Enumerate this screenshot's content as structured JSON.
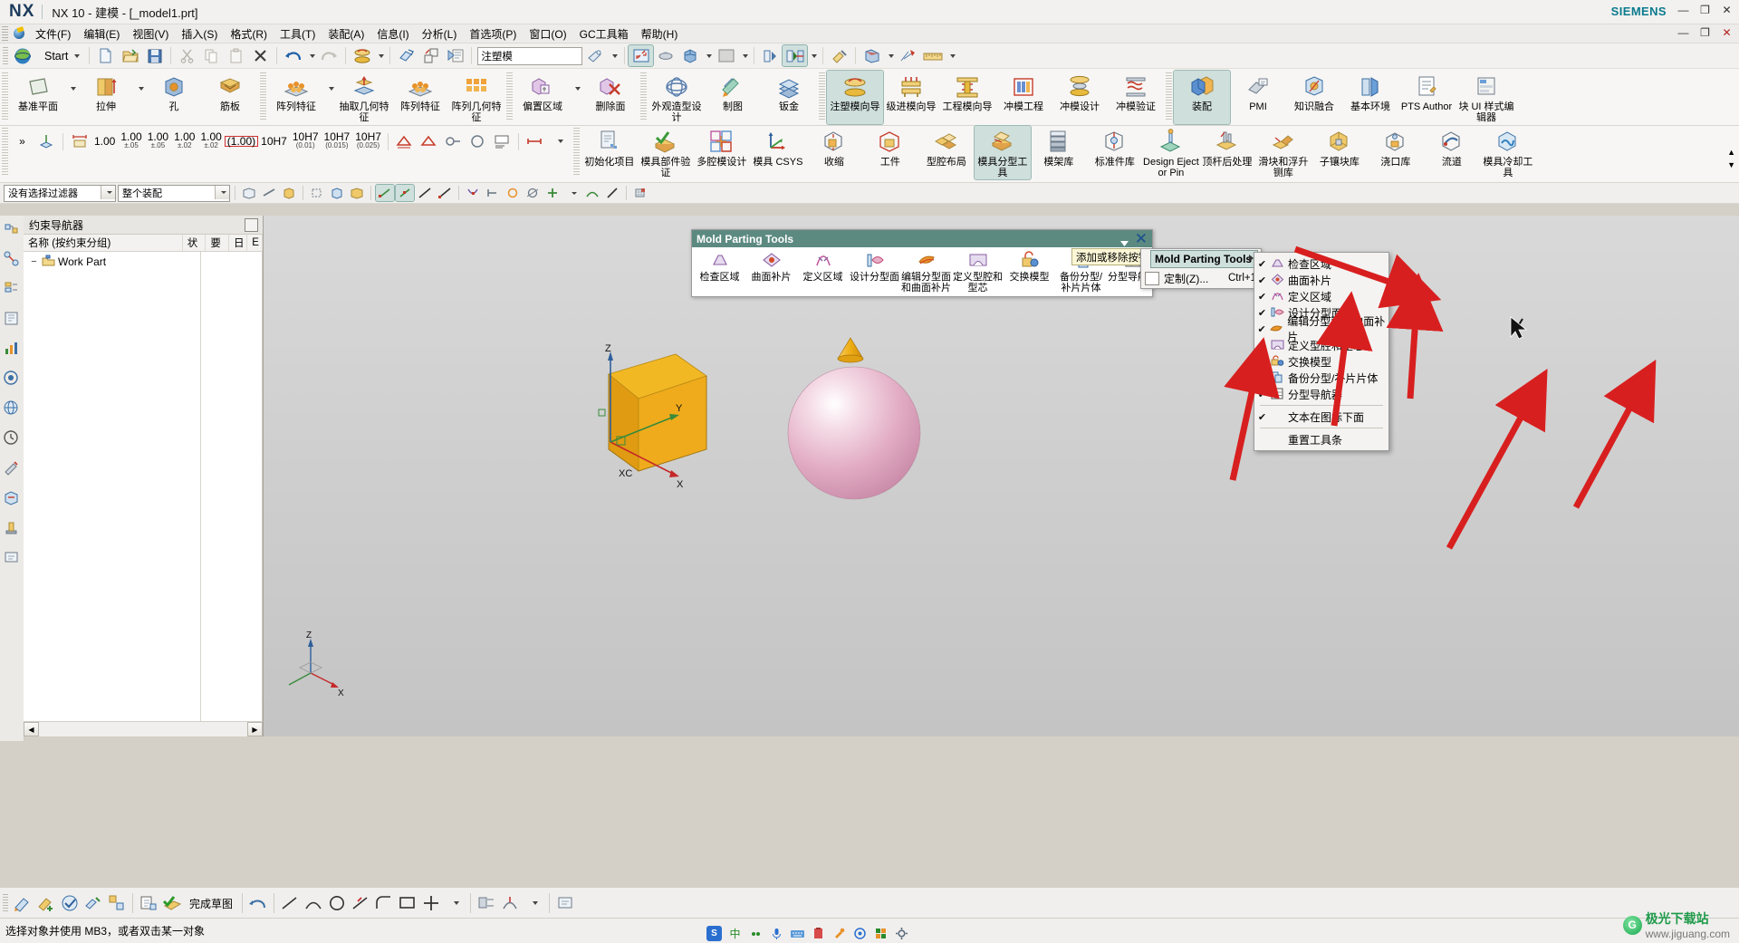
{
  "titlebar": {
    "logo": "NX",
    "title": "NX 10 - 建模 - [_model1.prt]",
    "brand": "SIEMENS",
    "minimize": "—",
    "maximize": "❐",
    "close": "✕"
  },
  "menubar": {
    "items": [
      {
        "label": "文件(F)"
      },
      {
        "label": "编辑(E)"
      },
      {
        "label": "视图(V)"
      },
      {
        "label": "插入(S)"
      },
      {
        "label": "格式(R)"
      },
      {
        "label": "工具(T)"
      },
      {
        "label": "装配(A)"
      },
      {
        "label": "信息(I)"
      },
      {
        "label": "分析(L)"
      },
      {
        "label": "首选项(P)"
      },
      {
        "label": "窗口(O)"
      },
      {
        "label": "GC工具箱"
      },
      {
        "label": "帮助(H)"
      }
    ],
    "minimize": "—",
    "restore": "❐",
    "close": "✕"
  },
  "quick_access": {
    "start_label": "Start",
    "search_value": "注塑模",
    "items": [
      "start-menu",
      "new-file",
      "open-file",
      "save-file",
      "cut",
      "copy",
      "paste",
      "delete",
      "undo",
      "redo",
      "mold-wizard",
      "transform",
      "move-object",
      "properties"
    ]
  },
  "ribbon_row1": [
    {
      "label": "基准平面",
      "icon": "datum-plane-icon",
      "dropdown": true,
      "selected": false
    },
    {
      "label": "拉伸",
      "icon": "extrude-icon",
      "dropdown": true,
      "selected": false
    },
    {
      "label": "孔",
      "icon": "hole-icon",
      "dropdown": false,
      "selected": false
    },
    {
      "label": "筋板",
      "icon": "rib-icon",
      "dropdown": false,
      "selected": false
    },
    {
      "label": "阵列特征",
      "icon": "pattern-feature-icon",
      "dropdown": true,
      "selected": false
    },
    {
      "label": "抽取几何特征",
      "icon": "extract-geometry-icon",
      "dropdown": false,
      "selected": false
    },
    {
      "label": "阵列特征",
      "icon": "pattern-feature2-icon",
      "dropdown": false,
      "selected": false
    },
    {
      "label": "阵列几何特征",
      "icon": "pattern-geometry-icon",
      "dropdown": false,
      "selected": false
    },
    {
      "label": "偏置区域",
      "icon": "offset-region-icon",
      "dropdown": true,
      "selected": false
    },
    {
      "label": "删除面",
      "icon": "delete-face-icon",
      "dropdown": false,
      "selected": false
    },
    {
      "label": "外观造型设计",
      "icon": "styling-design-icon",
      "dropdown": false,
      "selected": false
    },
    {
      "label": "制图",
      "icon": "drafting-icon",
      "dropdown": false,
      "selected": false
    },
    {
      "label": "钣金",
      "icon": "sheet-metal-icon",
      "dropdown": false,
      "selected": false
    },
    {
      "label": "注塑模向导",
      "icon": "mold-wizard-icon",
      "dropdown": false,
      "selected": true
    },
    {
      "label": "级进模向导",
      "icon": "progressive-die-icon",
      "dropdown": false,
      "selected": false
    },
    {
      "label": "工程模向导",
      "icon": "die-engineering-icon",
      "dropdown": false,
      "selected": false
    },
    {
      "label": "冲模工程",
      "icon": "stamping-die-icon",
      "dropdown": false,
      "selected": false
    },
    {
      "label": "冲模设计",
      "icon": "die-design-icon",
      "dropdown": false,
      "selected": false
    },
    {
      "label": "冲模验证",
      "icon": "die-validation-icon",
      "dropdown": false,
      "selected": false
    },
    {
      "label": "装配",
      "icon": "assembly-icon",
      "dropdown": false,
      "selected": true
    },
    {
      "label": "PMI",
      "icon": "pmi-icon",
      "dropdown": false,
      "selected": false
    },
    {
      "label": "知识融合",
      "icon": "knowledge-fusion-icon",
      "dropdown": false,
      "selected": false
    },
    {
      "label": "基本环境",
      "icon": "gateway-icon",
      "dropdown": false,
      "selected": false
    },
    {
      "label": "PTS Author",
      "icon": "pts-author-icon",
      "dropdown": false,
      "selected": false
    },
    {
      "label": "块 UI 样式编辑器",
      "icon": "block-ui-styler-icon",
      "dropdown": false,
      "selected": false
    }
  ],
  "ribbon_row2_dims": [
    {
      "value": "1.00",
      "tol": ""
    },
    {
      "value": "1.00",
      "tol": "±.05"
    },
    {
      "value": "1.00",
      "tol": "±.05"
    },
    {
      "value": "1.00",
      "tol": "±.02"
    },
    {
      "value": "1.00",
      "tol": "±.02"
    },
    {
      "value": "(1.00)",
      "tol": "",
      "boxed": true
    },
    {
      "value": "10H7",
      "tol": ""
    },
    {
      "value": "10H7",
      "tol": "(0.01)"
    },
    {
      "value": "10H7",
      "tol": "(0.015)"
    },
    {
      "value": "10H7",
      "tol": "(0.025)"
    }
  ],
  "ribbon_row2_tools": [
    {
      "label": "初始化项目",
      "icon": "init-project-icon"
    },
    {
      "label": "模具部件验证",
      "icon": "part-validation-icon"
    },
    {
      "label": "多腔模设计",
      "icon": "multi-cavity-icon"
    },
    {
      "label": "模具 CSYS",
      "icon": "mold-csys-icon"
    },
    {
      "label": "收缩",
      "icon": "shrinkage-icon"
    },
    {
      "label": "工件",
      "icon": "workpiece-icon"
    },
    {
      "label": "型腔布局",
      "icon": "cavity-layout-icon"
    },
    {
      "label": "模具分型工具",
      "icon": "mold-parting-tools-icon",
      "selected": true
    },
    {
      "label": "模架库",
      "icon": "mold-base-library-icon"
    },
    {
      "label": "标准件库",
      "icon": "standard-part-library-icon"
    },
    {
      "label": "Design Ejector Pin",
      "icon": "design-ejector-pin-icon"
    },
    {
      "label": "顶杆后处理",
      "icon": "ejector-post-process-icon"
    },
    {
      "label": "滑块和浮升铡库",
      "icon": "slide-lifter-icon"
    },
    {
      "label": "子镶块库",
      "icon": "sub-insert-library-icon"
    },
    {
      "label": "浇口库",
      "icon": "gate-library-icon"
    },
    {
      "label": "流道",
      "icon": "runner-icon"
    },
    {
      "label": "模具冷却工具",
      "icon": "cooling-tools-icon"
    }
  ],
  "filterbar": {
    "filter_value": "没有选择过滤器",
    "scope_value": "整个装配"
  },
  "navigator": {
    "title": "约束导航器",
    "columns": [
      "名称 (按约束分组)",
      "状",
      "要",
      "日",
      "E"
    ],
    "root_item": "Work Part",
    "expander": "−"
  },
  "mold_parting_toolbar": {
    "title": "Mold Parting Tools",
    "close": "✕",
    "buttons": [
      {
        "label": "检查区域",
        "icon": "check-region-icon"
      },
      {
        "label": "曲面补片",
        "icon": "surface-patch-icon"
      },
      {
        "label": "定义区域",
        "icon": "define-region-icon"
      },
      {
        "label": "设计分型面",
        "icon": "design-parting-surface-icon"
      },
      {
        "label": "编辑分型面和曲面补片",
        "icon": "edit-parting-surface-icon"
      },
      {
        "label": "定义型腔和型芯",
        "icon": "define-cavity-core-icon"
      },
      {
        "label": "交换模型",
        "icon": "swap-model-icon"
      },
      {
        "label": "备份分型/补片片体",
        "icon": "backup-parting-patch-icon"
      },
      {
        "label": "分型导航器",
        "icon": "parting-navigator-icon"
      }
    ]
  },
  "tooltip": {
    "text": "添加或移除按钮"
  },
  "context_menu_1": {
    "items": [
      {
        "label": "Mold Parting Tools",
        "highlighted": true,
        "submenu": true
      },
      {
        "label": "定制(Z)...",
        "shortcut": "Ctrl+1",
        "highlighted": false,
        "submenu": false
      }
    ]
  },
  "context_menu_2": {
    "items": [
      {
        "label": "检查区域",
        "checked": true,
        "icon": "check-region-icon"
      },
      {
        "label": "曲面补片",
        "checked": true,
        "icon": "surface-patch-icon"
      },
      {
        "label": "定义区域",
        "checked": true,
        "icon": "define-region-icon"
      },
      {
        "label": "设计分型面",
        "checked": true,
        "icon": "design-parting-surface-icon"
      },
      {
        "label": "编辑分型面和曲面补片",
        "checked": true,
        "icon": "edit-parting-surface-icon"
      },
      {
        "label": "定义型腔和型芯",
        "checked": true,
        "icon": "define-cavity-core-icon"
      },
      {
        "label": "交换模型",
        "checked": true,
        "icon": "swap-model-icon"
      },
      {
        "label": "备份分型/补片片体",
        "checked": true,
        "icon": "backup-parting-patch-icon"
      },
      {
        "label": "分型导航器",
        "checked": true,
        "icon": "parting-navigator-icon"
      }
    ],
    "text_below_icon": {
      "label": "文本在图标下面",
      "checked": true
    },
    "reset_toolbar": {
      "label": "重置工具条",
      "checked": false
    },
    "checkmark": "✔"
  },
  "graphics": {
    "csys_labels": {
      "x": "X",
      "y": "Y",
      "z": "Z",
      "xc": "XC"
    },
    "wcs_labels": {
      "x": "X",
      "z": "Z"
    },
    "colors": {
      "box_top": "#f2b824",
      "box_front": "#e8a517",
      "sphere": "#e8b6cc",
      "cone": "#f0b018",
      "arrow_red": "#d81f1f",
      "accent_teal": "#5c8a81"
    }
  },
  "statusbar": {
    "message": "选择对象并使用 MB3，或者双击某一对象",
    "tray_items": [
      "S",
      "中",
      "comma-icon",
      "mic-icon",
      "keyboard-icon",
      "clipboard-icon",
      "tools-icon",
      "at-icon",
      "grid-icon",
      "settings-icon"
    ],
    "watermark": {
      "letter": "G",
      "name": "极光下载站",
      "sub": "www.jiguang.com"
    }
  },
  "bottom_toolbar": {
    "items": [
      {
        "label": "",
        "icon": "sketch-icon"
      },
      {
        "label": "",
        "icon": "add-sketch-icon"
      },
      {
        "label": "",
        "icon": "finish-sketch-icon"
      },
      {
        "label": "",
        "icon": "sketch-constraint-icon"
      },
      {
        "label": "",
        "icon": "sketch-group-icon"
      },
      {
        "label": "",
        "icon": "profile-icon"
      },
      {
        "label": "完成草图",
        "icon": "complete-sketch-icon"
      },
      {
        "label": "",
        "icon": "undo-curve-icon"
      },
      {
        "label": "",
        "icon": "line-icon"
      },
      {
        "label": "",
        "icon": "arc-icon"
      },
      {
        "label": "",
        "icon": "circle-icon"
      },
      {
        "label": "",
        "icon": "trim-icon"
      },
      {
        "label": "",
        "icon": "fillet-icon"
      },
      {
        "label": "",
        "icon": "chamfer-icon"
      },
      {
        "label": "",
        "icon": "rectangle-icon"
      },
      {
        "label": "",
        "icon": "polygon-icon"
      },
      {
        "label": "",
        "icon": "dimension-icon"
      },
      {
        "label": "",
        "icon": "constraint-icon"
      }
    ],
    "label_complete": "完成草图"
  }
}
